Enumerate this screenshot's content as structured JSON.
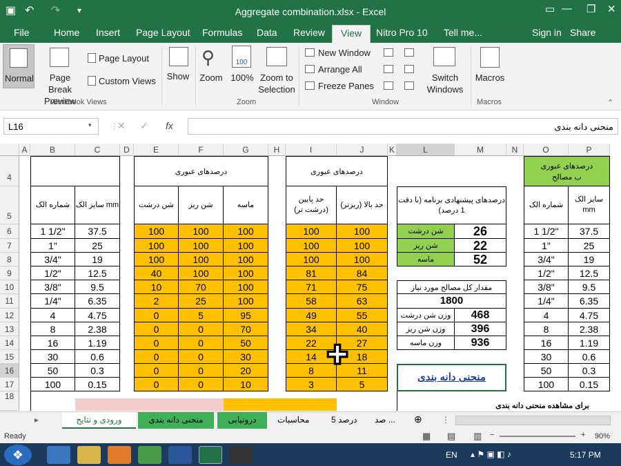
{
  "app": {
    "title": "Aggregate combination.xlsx - Excel"
  },
  "tabs": [
    "File",
    "Home",
    "Insert",
    "Page Layout",
    "Formulas",
    "Data",
    "Review",
    "View",
    "Nitro Pro 10",
    "Tell me...",
    "Sign in",
    "Share"
  ],
  "ribbon": {
    "normal": "Normal",
    "page_break": "Page Break Preview",
    "page_layout": "Page Layout",
    "custom_views": "Custom Views",
    "workbook_views": "Workbook Views",
    "show": "Show",
    "zoom": "Zoom",
    "zoom100": "100%",
    "zoom_sel": "Zoom to Selection",
    "zoom_grp": "Zoom",
    "new_window": "New Window",
    "arrange_all": "Arrange All",
    "freeze": "Freeze Panes",
    "switch": "Switch Windows",
    "window_grp": "Window",
    "macros": "Macros",
    "macros_grp": "Macros"
  },
  "formula": {
    "namebox": "L16",
    "fx": "fx",
    "content": "منحنی دانه بندی"
  },
  "columns": [
    "A",
    "B",
    "C",
    "D",
    "E",
    "F",
    "G",
    "H",
    "I",
    "J",
    "K",
    "L",
    "M",
    "N",
    "O",
    "P"
  ],
  "rows": [
    "4",
    "5",
    "6",
    "7",
    "8",
    "9",
    "10",
    "11",
    "12",
    "13",
    "14",
    "15",
    "16",
    "17",
    "18"
  ],
  "headers": {
    "passing": "درصدهای عبوری",
    "passing2": "درصدهای عبوری",
    "passing3": "درصدهای عبوری",
    "sieve_no": "شماره الک",
    "sieve_size": "سایز الک mm",
    "coarse": "شن درشت",
    "fine": "شن ریز",
    "sand": "ماسه",
    "lower": "حد پایین (درشت تر)",
    "upper": "حد بالا (ریزتر)",
    "program": "درصدهای پیشنهادی برنامه (با دقت 1 درصد)",
    "sieve_no2": "شماره الک",
    "sieve_size2": "سایز الک mm",
    "materials": "ب مصالح"
  },
  "table": [
    {
      "no": "1 1/2\"",
      "size": "37.5",
      "c": "100",
      "f": "100",
      "s": "100",
      "lo": "100",
      "hi": "100"
    },
    {
      "no": "1\"",
      "size": "25",
      "c": "100",
      "f": "100",
      "s": "100",
      "lo": "100",
      "hi": "100"
    },
    {
      "no": "3/4\"",
      "size": "19",
      "c": "100",
      "f": "100",
      "s": "100",
      "lo": "100",
      "hi": "100"
    },
    {
      "no": "1/2\"",
      "size": "12.5",
      "c": "40",
      "f": "100",
      "s": "100",
      "lo": "81",
      "hi": "84"
    },
    {
      "no": "3/8\"",
      "size": "9.5",
      "c": "10",
      "f": "70",
      "s": "100",
      "lo": "71",
      "hi": "75"
    },
    {
      "no": "1/4\"",
      "size": "6.35",
      "c": "2",
      "f": "25",
      "s": "100",
      "lo": "58",
      "hi": "63"
    },
    {
      "no": "4",
      "size": "4.75",
      "c": "0",
      "f": "5",
      "s": "95",
      "lo": "49",
      "hi": "55"
    },
    {
      "no": "8",
      "size": "2.38",
      "c": "0",
      "f": "0",
      "s": "70",
      "lo": "34",
      "hi": "40"
    },
    {
      "no": "16",
      "size": "1.19",
      "c": "0",
      "f": "0",
      "s": "50",
      "lo": "22",
      "hi": "27"
    },
    {
      "no": "30",
      "size": "0.6",
      "c": "0",
      "f": "0",
      "s": "30",
      "lo": "14",
      "hi": "18"
    },
    {
      "no": "50",
      "size": "0.3",
      "c": "0",
      "f": "0",
      "s": "20",
      "lo": "8",
      "hi": "11"
    },
    {
      "no": "100",
      "size": "0.15",
      "c": "0",
      "f": "0",
      "s": "10",
      "lo": "3",
      "hi": "5"
    }
  ],
  "right": {
    "coarse_lbl": "شن درشت",
    "coarse_val": "26",
    "fine_lbl": "شن ریز",
    "fine_val": "22",
    "sand_lbl": "ماسه",
    "sand_val": "52",
    "total_lbl": "مقدار کل مصالح مورد نیاز",
    "total_val": "1800",
    "w_coarse_lbl": "وزن شن درشت",
    "w_coarse": "468",
    "w_fine_lbl": "وزن شن ریز",
    "w_fine": "396",
    "w_sand_lbl": "وزن ماسه",
    "w_sand": "936",
    "curve": "منحنی دانه بندی",
    "note": "برای مشاهده منحنی دانه بندی"
  },
  "sheets": [
    "ورودی و نتایج",
    "منحنی دانه بندی",
    "درونیابی",
    "محاسبات",
    "5 درصد",
    "صد ..."
  ],
  "status": {
    "ready": "Ready",
    "zoom": "90%"
  },
  "taskbar": {
    "lang": "EN",
    "time": "5:17 PM"
  }
}
